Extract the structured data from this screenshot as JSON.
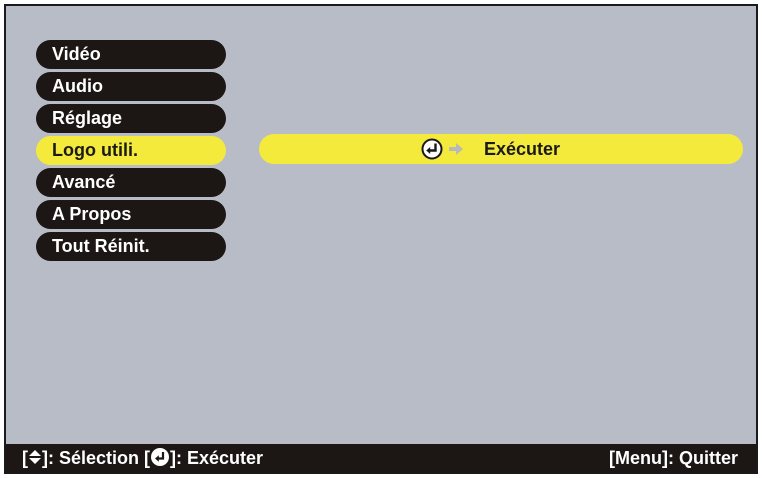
{
  "menu": {
    "items": [
      {
        "label": "Vidéo"
      },
      {
        "label": "Audio"
      },
      {
        "label": "Réglage"
      },
      {
        "label": "Logo utili."
      },
      {
        "label": "Avancé"
      },
      {
        "label": "A Propos"
      },
      {
        "label": "Tout Réinit."
      }
    ],
    "selected_index": 3
  },
  "submenu": {
    "icons": [
      "enter-icon",
      "arrow-right-icon"
    ],
    "action_label": "Exécuter"
  },
  "status_bar": {
    "select_open": "[",
    "select_close": "]: Sélection",
    "execute_open": "[",
    "execute_close": "]: Exécuter",
    "quit": "[Menu]: Quitter",
    "icons": [
      "up-down-arrow-icon",
      "enter-icon"
    ]
  },
  "colors": {
    "background": "#b7bcc7",
    "menu_item": "#1c1614",
    "highlight": "#f3ea3c",
    "text_light": "#ffffff",
    "text_dark": "#1a1a1a"
  }
}
